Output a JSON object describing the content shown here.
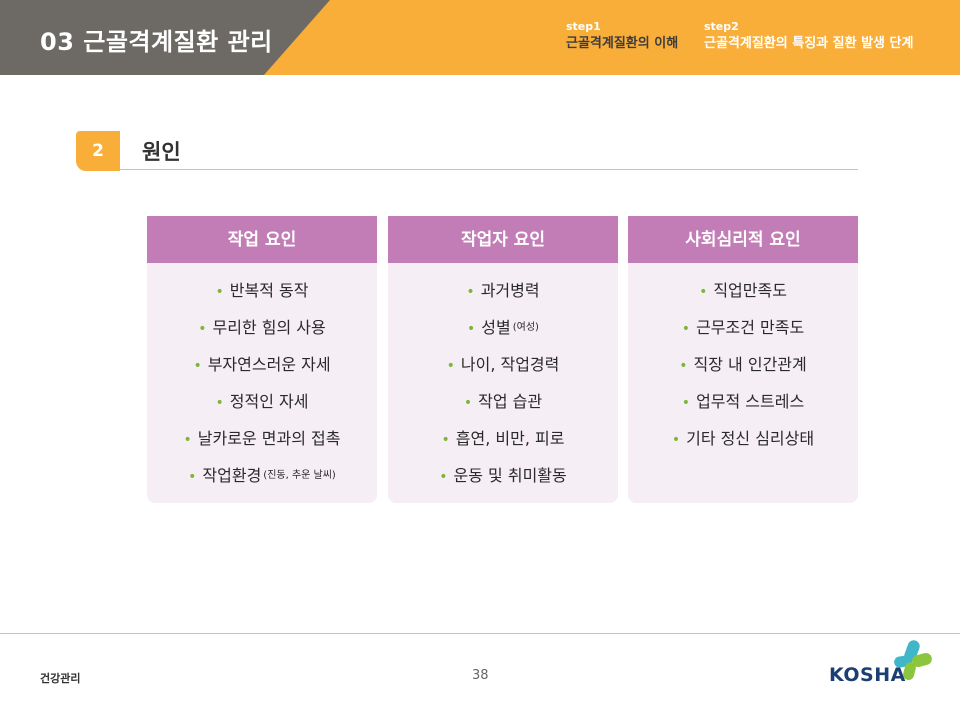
{
  "header": {
    "title": "03 근골격계질환 관리",
    "step1": {
      "label": "step1",
      "text": "근골격계질환의 이해"
    },
    "step2": {
      "label": "step2",
      "text": "근골격계질환의 특징과 질환 발생 단계"
    }
  },
  "section": {
    "number": "2",
    "title": "원인"
  },
  "cards": [
    {
      "title": "작업 요인",
      "items": [
        {
          "text": "반복적 동작",
          "note": ""
        },
        {
          "text": "무리한 힘의 사용",
          "note": ""
        },
        {
          "text": "부자연스러운 자세",
          "note": ""
        },
        {
          "text": "정적인 자세",
          "note": ""
        },
        {
          "text": "날카로운 면과의 접촉",
          "note": ""
        },
        {
          "text": "작업환경",
          "note": "(진동, 추운 날씨)"
        }
      ]
    },
    {
      "title": "작업자 요인",
      "items": [
        {
          "text": "과거병력",
          "note": ""
        },
        {
          "text": "성별",
          "note": "(여성)"
        },
        {
          "text": "나이, 작업경력",
          "note": ""
        },
        {
          "text": "작업 습관",
          "note": ""
        },
        {
          "text": "흡연, 비만, 피로",
          "note": ""
        },
        {
          "text": "운동 및 취미활동",
          "note": ""
        }
      ]
    },
    {
      "title": "사회심리적 요인",
      "items": [
        {
          "text": "직업만족도",
          "note": ""
        },
        {
          "text": "근무조건 만족도",
          "note": ""
        },
        {
          "text": "직장 내 인간관계",
          "note": ""
        },
        {
          "text": "업무적 스트레스",
          "note": ""
        },
        {
          "text": "기타 정신 심리상태",
          "note": ""
        }
      ]
    }
  ],
  "footer": {
    "label": "건강관리",
    "page_number": "38",
    "logo_text": "KOSHA"
  },
  "colors": {
    "header_orange": "#f9ae3a",
    "header_gray": "#6d6a65",
    "card_head": "#c27db6",
    "card_body": "#f5eef5",
    "bullet": "#7fb539"
  }
}
